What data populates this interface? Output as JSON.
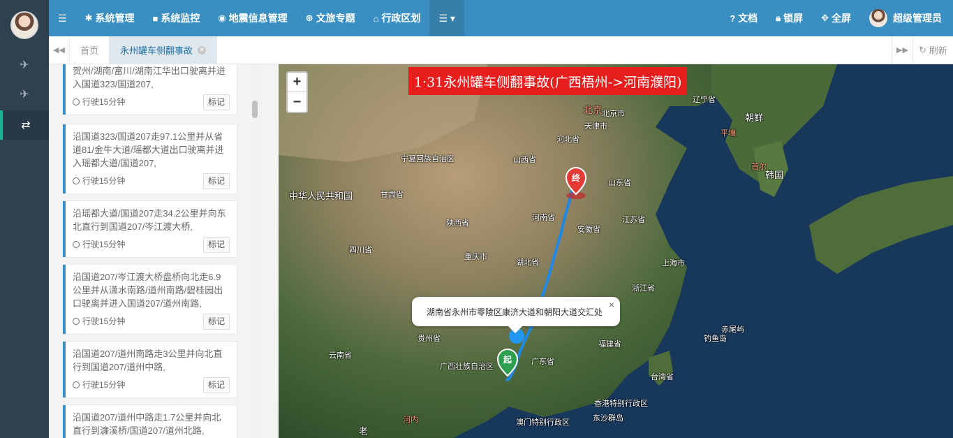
{
  "sidebar": {
    "nav_icons": [
      "plane-icon",
      "plane-icon",
      "retweet-icon"
    ]
  },
  "topbar": {
    "menu_toggle_icon": "bars-icon",
    "menus": [
      {
        "label": "系统管理",
        "icon": "gear-icon"
      },
      {
        "label": "系统监控",
        "icon": "video-icon"
      },
      {
        "label": "地震信息管理",
        "icon": "map-marker-icon"
      },
      {
        "label": "文旅专题",
        "icon": "globe-icon"
      },
      {
        "label": "行政区划",
        "icon": "bank-icon"
      }
    ],
    "more_icon": "list-icon",
    "right": [
      {
        "label": "文档",
        "icon": "question-icon"
      },
      {
        "label": "锁屏",
        "icon": "lock-icon"
      },
      {
        "label": "全屏",
        "icon": "expand-icon"
      },
      {
        "label": "超级管理员",
        "icon": "avatar"
      }
    ]
  },
  "tabs": {
    "home": "首页",
    "active": "永州罐车侧翻事故",
    "refresh": "刷新"
  },
  "route_steps": [
    {
      "text": "贺州/湖南/富川/湖南江华出口驶离并进入国道323/国道207,",
      "time": "行驶15分钟",
      "button": "标记"
    },
    {
      "text": "沿国道323/国道207走97.1公里并从省道81/金牛大道/瑶都大道出口驶离并进入瑶都大道/国道207,",
      "time": "行驶15分钟",
      "button": "标记"
    },
    {
      "text": "沿瑶都大道/国道207走34.2公里并向东北直行到国道207/岑江渡大桥,",
      "time": "行驶15分钟",
      "button": "标记"
    },
    {
      "text": "沿国道207/岑江渡大桥盘桥向北走6.9公里并从潇水南路/道州南路/碧桂园出口驶离并进入国道207/道州南路,",
      "time": "行驶15分钟",
      "button": "标记"
    },
    {
      "text": "沿国道207/道州南路走3公里并向北直行到国道207/道州中路,",
      "time": "行驶15分钟",
      "button": "标记"
    },
    {
      "text": "沿国道207/道州中路走1.7公里并向北直行到濂溪桥/国道207/道州北路,",
      "time": "",
      "button": ""
    }
  ],
  "map": {
    "title": "1·31永州罐车侧翻事故(广西梧州->河南濮阳)",
    "zoom_in": "+",
    "zoom_out": "−",
    "popup_text": "湖南省永州市零陵区康济大道和朝阳大道交汇处",
    "popup_close": "×",
    "start_marker": "起",
    "end_marker": "终",
    "route_color": "#1e88e5",
    "labels": [
      "北京",
      "北京市",
      "天津市",
      "河北省",
      "山西省",
      "宁夏回族自治区",
      "甘肃省",
      "中华人民共和国",
      "山东省",
      "河南省",
      "陕西省",
      "江苏省",
      "安徽省",
      "四川省",
      "重庆市",
      "湖北省",
      "上海市",
      "浙江省",
      "贵州省",
      "云南省",
      "广西壮族自治区",
      "广东省",
      "福建省",
      "台湾省",
      "赤尾屿",
      "钓鱼岛",
      "香港特别行政区",
      "澳门特别行政区",
      "东沙群岛",
      "河内",
      "老",
      "朝鲜",
      "平壤",
      "首尔",
      "韩国",
      "辽宁省"
    ]
  }
}
